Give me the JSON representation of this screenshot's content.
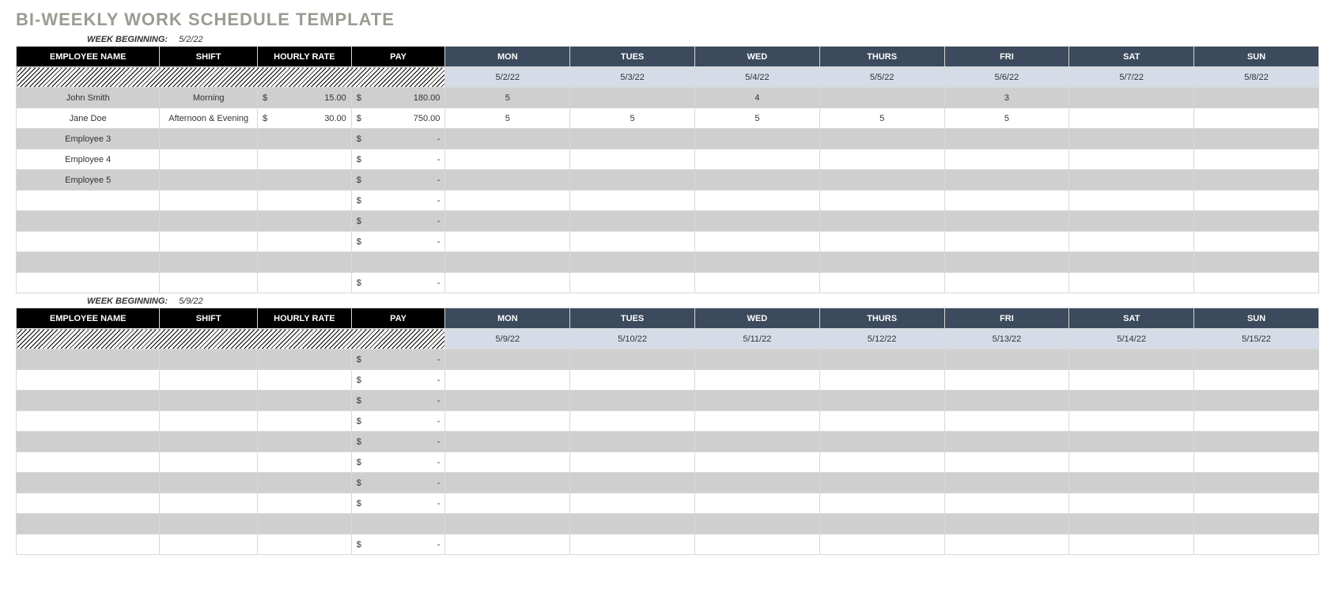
{
  "title": "BI-WEEKLY WORK SCHEDULE TEMPLATE",
  "weekBeginningLabel": "WEEK BEGINNING:",
  "headers": {
    "name": "EMPLOYEE NAME",
    "shift": "SHIFT",
    "rate": "HOURLY RATE",
    "pay": "PAY",
    "days": [
      "MON",
      "TUES",
      "WED",
      "THURS",
      "FRI",
      "SAT",
      "SUN"
    ]
  },
  "weeks": [
    {
      "beginning": "5/2/22",
      "dates": [
        "5/2/22",
        "5/3/22",
        "5/4/22",
        "5/5/22",
        "5/6/22",
        "5/7/22",
        "5/8/22"
      ],
      "rows": [
        {
          "name": "John Smith",
          "shift": "Morning",
          "rate": "15.00",
          "pay": "180.00",
          "d": [
            "5",
            "",
            "4",
            "",
            "3",
            "",
            ""
          ]
        },
        {
          "name": "Jane Doe",
          "shift": "Afternoon & Evening",
          "rate": "30.00",
          "pay": "750.00",
          "d": [
            "5",
            "5",
            "5",
            "5",
            "5",
            "",
            ""
          ]
        },
        {
          "name": "Employee 3",
          "shift": "",
          "rate": "",
          "pay": "-",
          "d": [
            "",
            "",
            "",
            "",
            "",
            "",
            ""
          ]
        },
        {
          "name": "Employee 4",
          "shift": "",
          "rate": "",
          "pay": "-",
          "d": [
            "",
            "",
            "",
            "",
            "",
            "",
            ""
          ]
        },
        {
          "name": "Employee 5",
          "shift": "",
          "rate": "",
          "pay": "-",
          "d": [
            "",
            "",
            "",
            "",
            "",
            "",
            ""
          ]
        },
        {
          "name": "",
          "shift": "",
          "rate": "",
          "pay": "-",
          "d": [
            "",
            "",
            "",
            "",
            "",
            "",
            ""
          ]
        },
        {
          "name": "",
          "shift": "",
          "rate": "",
          "pay": "-",
          "d": [
            "",
            "",
            "",
            "",
            "",
            "",
            ""
          ]
        },
        {
          "name": "",
          "shift": "",
          "rate": "",
          "pay": "-",
          "d": [
            "",
            "",
            "",
            "",
            "",
            "",
            ""
          ]
        },
        {
          "name": "",
          "shift": "",
          "rate": "",
          "pay": "",
          "d": [
            "",
            "",
            "",
            "",
            "",
            "",
            ""
          ],
          "nosym": true
        },
        {
          "name": "",
          "shift": "",
          "rate": "",
          "pay": "-",
          "d": [
            "",
            "",
            "",
            "",
            "",
            "",
            ""
          ]
        }
      ]
    },
    {
      "beginning": "5/9/22",
      "dates": [
        "5/9/22",
        "5/10/22",
        "5/11/22",
        "5/12/22",
        "5/13/22",
        "5/14/22",
        "5/15/22"
      ],
      "rows": [
        {
          "name": "",
          "shift": "",
          "rate": "",
          "pay": "-",
          "d": [
            "",
            "",
            "",
            "",
            "",
            "",
            ""
          ]
        },
        {
          "name": "",
          "shift": "",
          "rate": "",
          "pay": "-",
          "d": [
            "",
            "",
            "",
            "",
            "",
            "",
            ""
          ]
        },
        {
          "name": "",
          "shift": "",
          "rate": "",
          "pay": "-",
          "d": [
            "",
            "",
            "",
            "",
            "",
            "",
            ""
          ]
        },
        {
          "name": "",
          "shift": "",
          "rate": "",
          "pay": "-",
          "d": [
            "",
            "",
            "",
            "",
            "",
            "",
            ""
          ]
        },
        {
          "name": "",
          "shift": "",
          "rate": "",
          "pay": "-",
          "d": [
            "",
            "",
            "",
            "",
            "",
            "",
            ""
          ]
        },
        {
          "name": "",
          "shift": "",
          "rate": "",
          "pay": "-",
          "d": [
            "",
            "",
            "",
            "",
            "",
            "",
            ""
          ]
        },
        {
          "name": "",
          "shift": "",
          "rate": "",
          "pay": "-",
          "d": [
            "",
            "",
            "",
            "",
            "",
            "",
            ""
          ]
        },
        {
          "name": "",
          "shift": "",
          "rate": "",
          "pay": "-",
          "d": [
            "",
            "",
            "",
            "",
            "",
            "",
            ""
          ]
        },
        {
          "name": "",
          "shift": "",
          "rate": "",
          "pay": "",
          "d": [
            "",
            "",
            "",
            "",
            "",
            "",
            ""
          ],
          "nosym": true
        },
        {
          "name": "",
          "shift": "",
          "rate": "",
          "pay": "-",
          "d": [
            "",
            "",
            "",
            "",
            "",
            "",
            ""
          ]
        }
      ]
    }
  ]
}
